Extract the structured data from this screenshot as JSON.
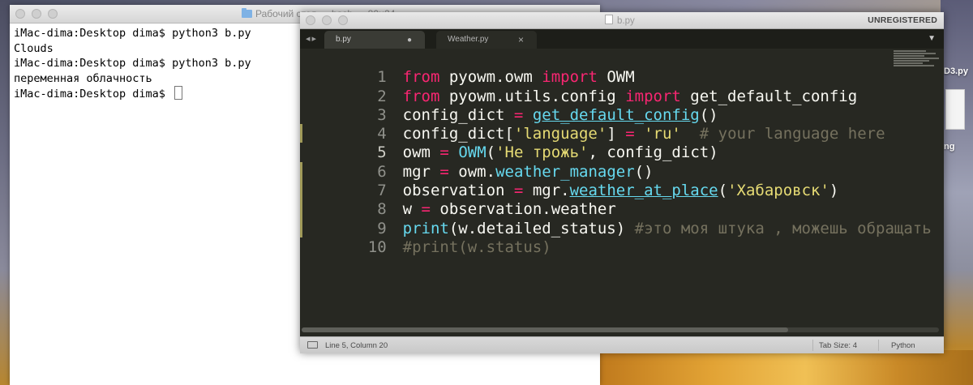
{
  "desktop": {
    "right_label_1": "D3.py",
    "right_label_2": "ng"
  },
  "terminal": {
    "title": "Рабочий стол — bash — 80×24",
    "lines": [
      "iMac-dima:Desktop dima$ python3 b.py",
      "Clouds",
      "iMac-dima:Desktop dima$ python3 b.py",
      "переменная облачность",
      "iMac-dima:Desktop dima$ "
    ]
  },
  "editor": {
    "window_title": "b.py",
    "license_label": "UNREGISTERED",
    "tabs": [
      {
        "label": "b.py",
        "active": true
      },
      {
        "label": "Weather.py",
        "active": false
      }
    ],
    "line_numbers": [
      "1",
      "2",
      "3",
      "4",
      "5",
      "6",
      "7",
      "8",
      "9",
      "10"
    ],
    "code": {
      "l1": {
        "a": "from",
        "b": " pyowm.owm ",
        "c": "import",
        "d": " OWM"
      },
      "l2": {
        "a": "from",
        "b": " pyowm.utils.config ",
        "c": "import",
        "d": " get_default_config"
      },
      "l3": {
        "a": "config_dict ",
        "b": "=",
        "c": " ",
        "d": "get_default_config",
        "e": "()"
      },
      "l4": {
        "a": "config_dict[",
        "b": "'language'",
        "c": "] ",
        "d": "=",
        "e": " ",
        "f": "'ru'",
        "g": "  # your language here"
      },
      "l5": {
        "a": "owm ",
        "b": "=",
        "c": " ",
        "d": "OWM",
        "e": "(",
        "f": "'Не трожь'",
        "g": ", config_dict)"
      },
      "l6": {
        "a": "mgr ",
        "b": "=",
        "c": " owm.",
        "d": "weather_manager",
        "e": "()"
      },
      "l7": {
        "a": "observation ",
        "b": "=",
        "c": " mgr.",
        "d": "weather_at_place",
        "e": "(",
        "f": "'Хабаровск'",
        "g": ")"
      },
      "l8": {
        "a": "w ",
        "b": "=",
        "c": " observation.weather"
      },
      "l9": {
        "a": "print",
        "b": "(w.detailed_status) ",
        "c": "#это моя штука , можешь обращать"
      },
      "l10": {
        "a": "#print(w.status)"
      }
    },
    "status": {
      "position": "Line 5, Column 20",
      "tab_size": "Tab Size: 4",
      "syntax": "Python"
    }
  },
  "colors": {
    "keyword": "#f92672",
    "function": "#66d9ef",
    "string": "#e6db74",
    "comment": "#75715e",
    "text": "#f8f8f2",
    "editor_bg": "#272822"
  }
}
